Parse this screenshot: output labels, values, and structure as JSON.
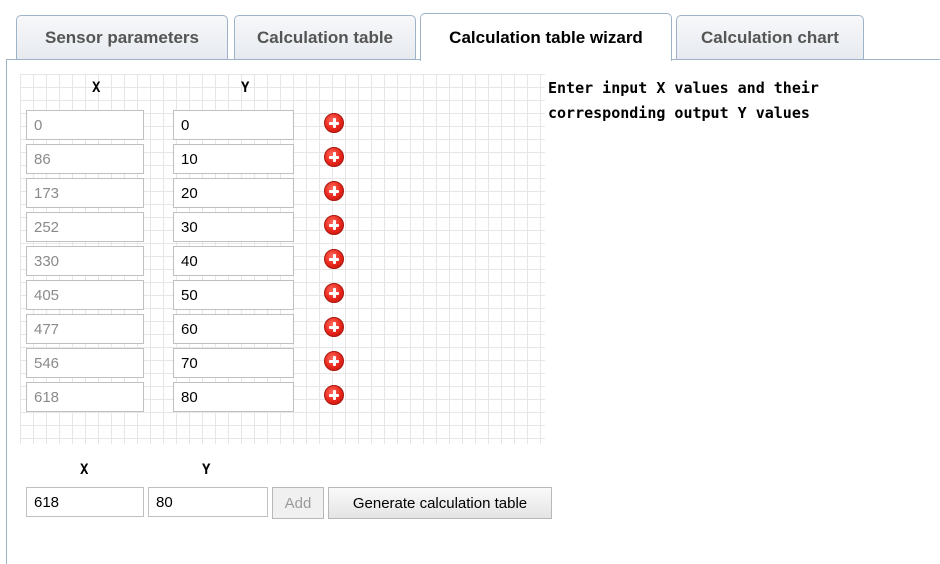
{
  "tabs": [
    {
      "label": "Sensor parameters",
      "active": false
    },
    {
      "label": "Calculation table",
      "active": false
    },
    {
      "label": "Calculation table wizard",
      "active": true
    },
    {
      "label": "Calculation chart",
      "active": false
    }
  ],
  "table": {
    "x_header": "X",
    "y_header": "Y",
    "rows": [
      {
        "x": "0",
        "y": "0"
      },
      {
        "x": "86",
        "y": "10"
      },
      {
        "x": "173",
        "y": "20"
      },
      {
        "x": "252",
        "y": "30"
      },
      {
        "x": "330",
        "y": "40"
      },
      {
        "x": "405",
        "y": "50"
      },
      {
        "x": "477",
        "y": "60"
      },
      {
        "x": "546",
        "y": "70"
      },
      {
        "x": "618",
        "y": "80"
      }
    ]
  },
  "instructions": "Enter input X values and their corresponding output Y values",
  "entry": {
    "x_label": "X",
    "y_label": "Y",
    "x_value": "618",
    "y_value": "80",
    "add_label": "Add",
    "generate_label": "Generate calculation table"
  },
  "colors": {
    "delete_icon": "#e8251a",
    "tab_border": "#9fb3c8",
    "grid_line": "#e6e6e6"
  }
}
